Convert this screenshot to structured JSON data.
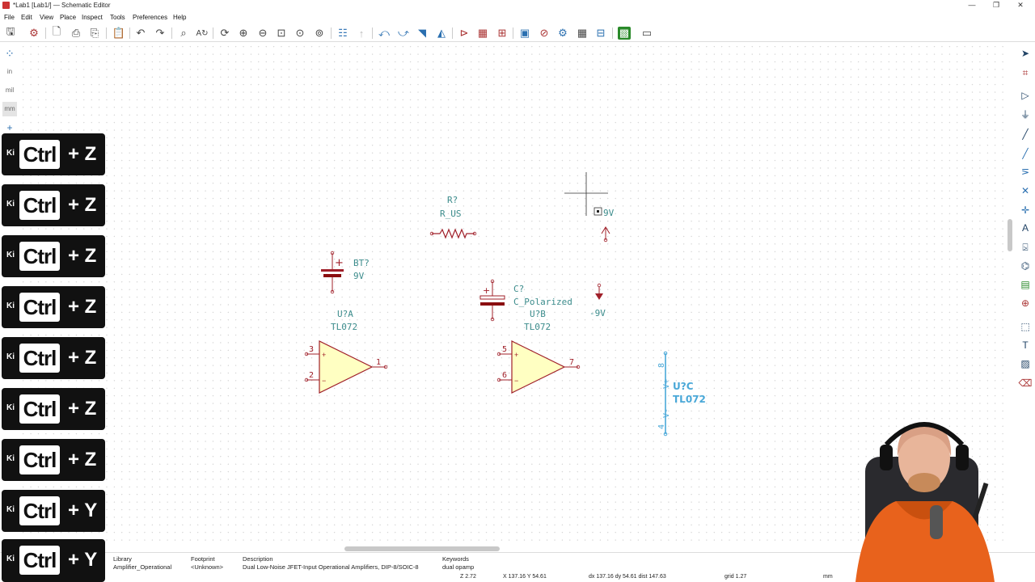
{
  "window": {
    "title": "*Lab1 [Lab1/] — Schematic Editor",
    "controls": [
      "—",
      "❐",
      "✕"
    ]
  },
  "menu": [
    "File",
    "Edit",
    "View",
    "Place",
    "Inspect",
    "Tools",
    "Preferences",
    "Help"
  ],
  "toolbar": {
    "icons": [
      "save-icon",
      "schematic-setup-icon",
      "page-settings-icon",
      "print-icon",
      "plot-icon",
      "paste-icon",
      "undo-icon",
      "redo-icon",
      "find-icon",
      "find-replace-icon",
      "refresh-icon",
      "zoom-in-icon",
      "zoom-out-icon",
      "zoom-fit-icon",
      "zoom-objects-icon",
      "zoom-tool-icon",
      "hierarchy-icon",
      "leave-sheet-icon",
      "rotate-ccw-icon",
      "rotate-cw-icon",
      "mirror-v-icon",
      "mirror-h-icon",
      "symbol-editor-icon",
      "symbol-browser-icon",
      "annotate-icon",
      "erc-icon",
      "footprint-assign-icon",
      "bom-icon",
      "netlist-icon",
      "pcb-icon",
      "scripting-icon"
    ]
  },
  "left_toolbar": {
    "items": [
      "grid",
      "in",
      "mil",
      "mm",
      "+"
    ]
  },
  "right_toolbar": {
    "icons": [
      "select-icon",
      "highlight-net-icon",
      "add-symbol-icon",
      "add-power-icon",
      "add-wire-icon",
      "add-bus-icon",
      "wire-to-bus-icon",
      "no-connect-icon",
      "junction-icon",
      "label-icon",
      "global-label-icon",
      "hier-label-icon",
      "hier-sheet-icon",
      "import-sheet-pin-icon",
      "line-icon",
      "text-icon",
      "image-icon",
      "delete-icon"
    ]
  },
  "schematic": {
    "resistor": {
      "ref": "R?",
      "value": "R_US"
    },
    "battery": {
      "ref": "BT?",
      "value": "9V",
      "plus": "+"
    },
    "capacitor": {
      "ref": "C?",
      "value": "C_Polarized",
      "plus": "+"
    },
    "opamp_a": {
      "ref": "U?A",
      "value": "TL072",
      "pin_in_pos": "3",
      "pin_in_neg": "2",
      "pin_out": "1"
    },
    "opamp_b": {
      "ref": "U?B",
      "value": "TL072",
      "pin_in_pos": "5",
      "pin_in_neg": "6",
      "pin_out": "7"
    },
    "opamp_c": {
      "ref": "U?C",
      "value": "TL072",
      "pin_top": "8",
      "pin_bottom": "4",
      "label_top": "V+",
      "label_bottom": "V-"
    },
    "power_pos": {
      "value": "9V"
    },
    "power_neg": {
      "value": "-9V"
    }
  },
  "message_panel": {
    "library_label": "Library",
    "library_value": "Amplifier_Operational",
    "footprint_label": "Footprint",
    "footprint_value": "<Unknown>",
    "description_label": "Description",
    "description_value": "Dual Low-Noise JFET-Input Operational Amplifiers, DIP-8/SOIC-8",
    "keywords_label": "Keywords",
    "keywords_value": "dual opamp"
  },
  "status": {
    "zoom": "Z 2.72",
    "cursor": "X 137.16  Y 54.61",
    "delta": "dx 137.16  dy 54.61  dist 147.63",
    "grid": "grid 1.27",
    "units": "mm"
  },
  "key_overlay": {
    "ki": "Ki",
    "ctrl": "Ctrl",
    "combos": [
      "+ Z",
      "+ Z",
      "+ Z",
      "+ Z",
      "+ Z",
      "+ Z",
      "+ Z",
      "+ Y",
      "+ Y"
    ]
  },
  "colors": {
    "ref_text": "#3c8c8c",
    "pin_red": "#a0202a",
    "opamp_fill": "#ffffc2",
    "selected": "#4aa8d8"
  }
}
